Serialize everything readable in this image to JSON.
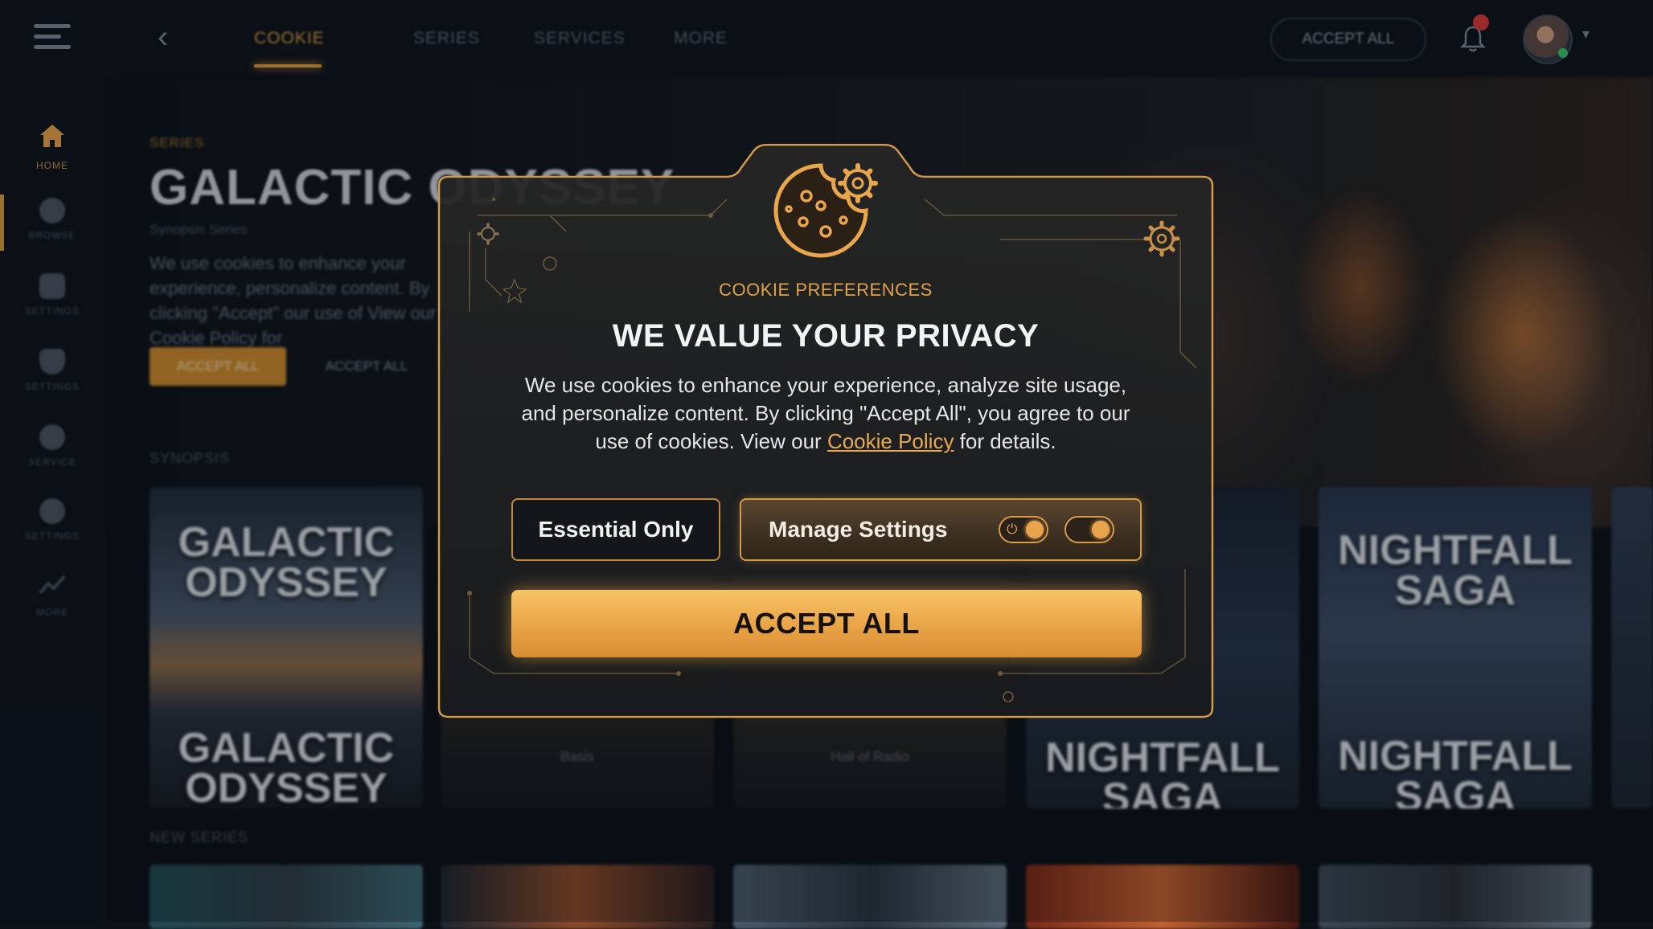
{
  "topbar": {
    "tabs": [
      {
        "label": "COOKIE",
        "active": true
      },
      {
        "label": "SERIES",
        "active": false
      },
      {
        "label": "SERVICES",
        "active": false
      },
      {
        "label": "MORE",
        "active": false
      }
    ],
    "accept_all_label": "ACCEPT ALL",
    "accent_color": "#d79a3d"
  },
  "sidebar": {
    "items": [
      {
        "label": "HOME",
        "icon": "home-icon",
        "active": true
      },
      {
        "label": "BROWSE",
        "icon": "clock-icon"
      },
      {
        "label": "SETTINGS",
        "icon": "grid-icon"
      },
      {
        "label": "SETTINGS",
        "icon": "shield-icon"
      },
      {
        "label": "SERVICE",
        "icon": "circle-icon"
      },
      {
        "label": "SETTINGS",
        "icon": "gear-icon"
      },
      {
        "label": "MORE",
        "icon": "trend-icon"
      }
    ]
  },
  "hero": {
    "eyebrow": "SERIES",
    "title": "GALACTIC ODYSSEY",
    "subtitle": "Synopsis Series",
    "description": "We use cookies to enhance your experience, personalize content. By clicking \"Accept\" our use of View our Cookie Policy for",
    "primary_button": "ACCEPT ALL",
    "secondary_button": "ACCEPT ALL",
    "synopsis_label": "SYNOPSIS",
    "new_series_label": "NEW SERIES"
  },
  "posters": [
    {
      "title": "GALACTIC ODYSSEY",
      "caption": "GALACTIC ODYSSEY"
    },
    {
      "title": "",
      "caption": "Basis"
    },
    {
      "title": "",
      "caption": "Hall of Radio"
    },
    {
      "title": "",
      "caption": "NIGHTFALL SAGA"
    },
    {
      "title": "NIGHTFALL SAGA",
      "caption": "NIGHTFALL SAGA"
    }
  ],
  "modal": {
    "eyebrow": "COOKIE PREFERENCES",
    "title": "WE VALUE YOUR PRIVACY",
    "body_before_link": "We use cookies to enhance your experience, analyze site usage, and personalize content. By clicking \"Accept All\", you agree to our use of cookies. View our ",
    "link_text": "Cookie Policy",
    "body_after_link": " for details.",
    "essential_label": "Essential Only",
    "manage_label": "Manage Settings",
    "accept_label": "ACCEPT ALL",
    "toggle_1_on": true,
    "toggle_2_on": true,
    "gold_color": "#eaa648"
  }
}
